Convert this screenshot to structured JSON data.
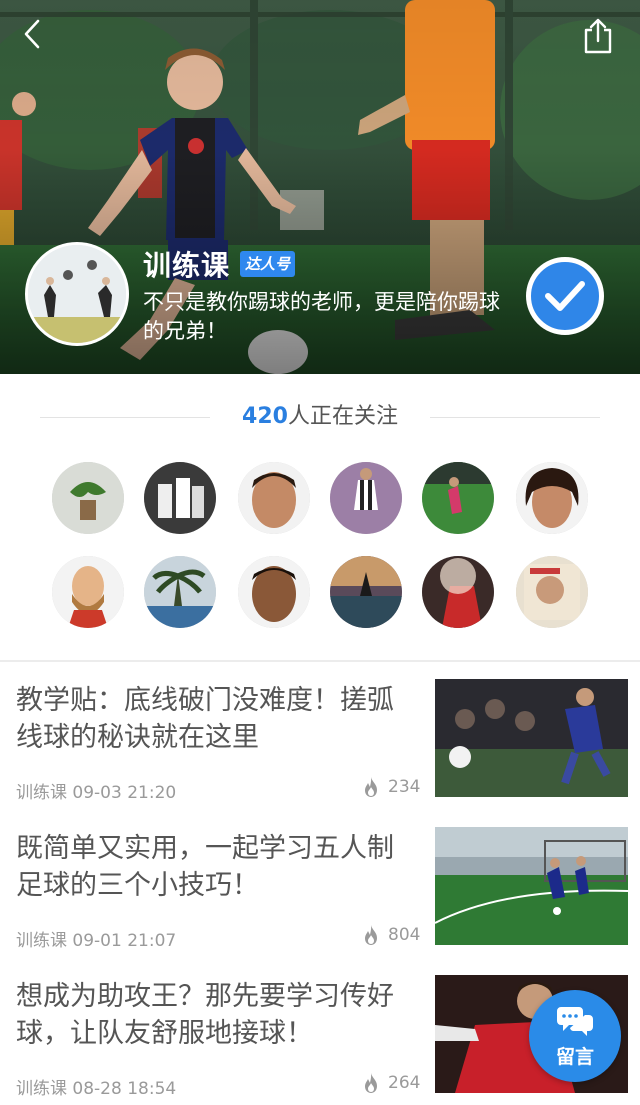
{
  "header": {
    "back_icon": "chevron-left-icon",
    "share_icon": "share-icon"
  },
  "profile": {
    "name": "训练课",
    "badge": "达人号",
    "tagline": "不只是教你踢球的老师，更是陪你踢球的兄弟！",
    "followed": true
  },
  "followers": {
    "count": "420",
    "label": "人正在关注",
    "avatars": [
      {
        "name": "follower-avatar-1"
      },
      {
        "name": "follower-avatar-2"
      },
      {
        "name": "follower-avatar-3"
      },
      {
        "name": "follower-avatar-4"
      },
      {
        "name": "follower-avatar-5"
      },
      {
        "name": "follower-avatar-6"
      },
      {
        "name": "follower-avatar-7"
      },
      {
        "name": "follower-avatar-8"
      },
      {
        "name": "follower-avatar-9"
      },
      {
        "name": "follower-avatar-10"
      },
      {
        "name": "follower-avatar-11"
      },
      {
        "name": "follower-avatar-12"
      }
    ]
  },
  "articles": [
    {
      "title": "教学贴：底线破门没难度！搓弧线球的秘诀就在这里",
      "author": "训练课",
      "date": "09-03 21:20",
      "views": "234"
    },
    {
      "title": "既简单又实用，一起学习五人制足球的三个小技巧！",
      "author": "训练课",
      "date": "09-01 21:07",
      "views": "804"
    },
    {
      "title": "想成为助攻王？那先要学习传好球，让队友舒服地接球！",
      "author": "训练课",
      "date": "08-28 18:54",
      "views": "264"
    }
  ],
  "comment_button": {
    "label": "留言",
    "icon": "chat-bubble-icon"
  },
  "colors": {
    "accent": "#2a7fe0",
    "badge": "#2f88ee",
    "meta_text": "#9a9a9a"
  }
}
